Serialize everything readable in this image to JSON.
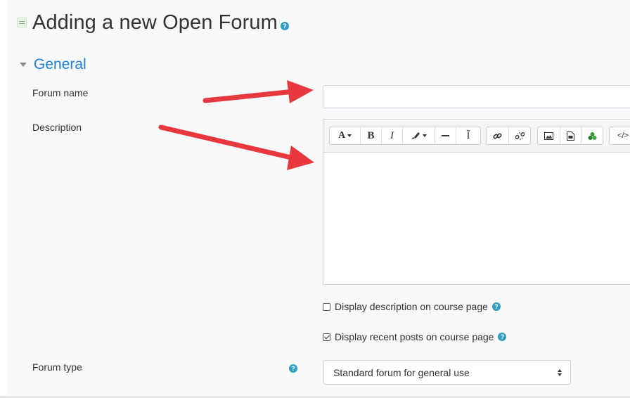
{
  "page": {
    "title": "Adding a new Open Forum",
    "help_icon": "question-circle-icon",
    "page_icon": "forum-activity-icon"
  },
  "section": {
    "title": "General",
    "collapse_icon": "caret-down-icon"
  },
  "fields": {
    "forum_name": {
      "label": "Forum name",
      "value": "",
      "placeholder": ""
    },
    "description": {
      "label": "Description",
      "value": ""
    },
    "forum_type": {
      "label": "Forum type",
      "selected": "Standard forum for general use"
    }
  },
  "editor_toolbar": {
    "buttons": [
      {
        "name": "font-size",
        "glyph": "A",
        "icon": "font-size-icon"
      },
      {
        "name": "bold",
        "glyph": "B",
        "icon": "bold-icon"
      },
      {
        "name": "italic",
        "glyph": "I",
        "icon": "italic-icon"
      },
      {
        "name": "text-color",
        "glyph": "",
        "icon": "paintbrush-icon"
      },
      {
        "name": "horizontal-rule",
        "glyph": "",
        "icon": "horizontal-rule-icon"
      },
      {
        "name": "clear-formatting",
        "glyph": "Ĩ",
        "icon": "clear-formatting-icon"
      },
      {
        "name": "link",
        "glyph": "",
        "icon": "link-icon"
      },
      {
        "name": "unlink",
        "glyph": "",
        "icon": "unlink-icon"
      },
      {
        "name": "image",
        "glyph": "",
        "icon": "image-icon"
      },
      {
        "name": "media",
        "glyph": "",
        "icon": "media-file-icon"
      },
      {
        "name": "recorder",
        "glyph": "",
        "icon": "recorder-icon"
      },
      {
        "name": "html",
        "glyph": "</>",
        "icon": "code-icon"
      }
    ]
  },
  "checkboxes": [
    {
      "label": "Display description on course page",
      "checked": false
    },
    {
      "label": "Display recent posts on course page",
      "checked": true
    }
  ],
  "annotations": {
    "arrow_color": "#e8383d"
  },
  "colors": {
    "section_title": "#1f7fd6",
    "help_icon": "#2f9fc2"
  }
}
